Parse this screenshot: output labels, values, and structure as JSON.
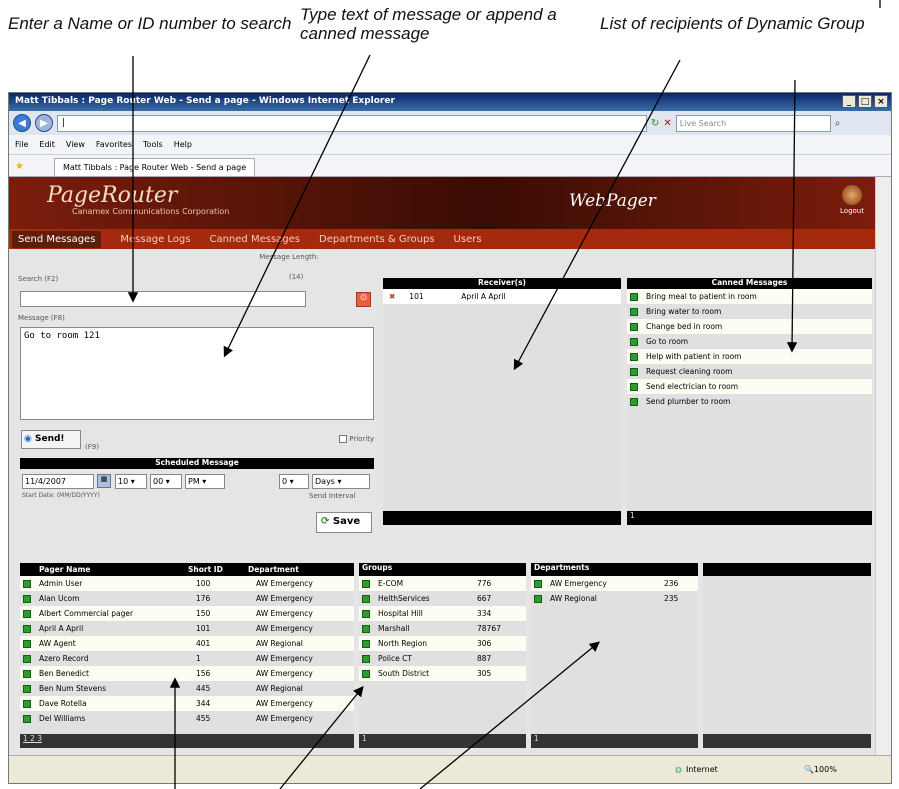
{
  "annotations": {
    "search_hint": "Enter a Name or ID number to search",
    "message_hint": "Type text of message or append a canned message",
    "recipients_hint": "List of recipients of Dynamic Group"
  },
  "browser": {
    "title": "Matt Tibbals : Page Router Web - Send a page - Windows Internet Explorer",
    "address": "|",
    "search_placeholder": "Live Search",
    "menu": [
      "File",
      "Edit",
      "View",
      "Favorites",
      "Tools",
      "Help"
    ],
    "tab_label": "Matt Tibbals : Page Router Web - Send a page",
    "status_zone": "Internet",
    "zoom": "100%"
  },
  "app": {
    "logo_main": "PageRouter",
    "logo_sub": "Canamex Communications Corporation",
    "brand_right": "WebPager",
    "logout_label": "Logout",
    "nav": [
      "Send Messages",
      "Message Logs",
      "Canned Messages",
      "Departments & Groups",
      "Users"
    ],
    "search_label": "Search (F2)",
    "message_length_label": "Message Length:",
    "message_length_value": "(14)",
    "message_label": "Message (F8)",
    "message_value": "Go to room 121",
    "send_label": "Send!",
    "send_shortcut": "(F9)",
    "priority_label": "Priority",
    "scheduled_title": "Scheduled Message",
    "start_date": "11/4/2007",
    "hour": "10",
    "minute": "00",
    "ampm": "PM",
    "interval_value": "0",
    "interval_unit": "Days",
    "start_date_label": "Start Date: (MM/DD/YYYY)",
    "send_interval_label": "Send Interval",
    "save_label": "Save",
    "receivers": {
      "title": "Receiver(s)",
      "rows": [
        {
          "id": "101",
          "name": "April A April"
        }
      ]
    },
    "canned": {
      "title": "Canned Messages",
      "items": [
        "Bring meal to patient in room",
        "Bring water to room",
        "Change bed in room",
        "Go to room",
        "Help with patient in room",
        "Request cleaning room",
        "Send electrician to room",
        "Send plumber to room"
      ],
      "footer": "1"
    },
    "pagers": {
      "headers": [
        "Pager Name",
        "Short ID",
        "Department"
      ],
      "rows": [
        [
          "Admin User",
          "100",
          "AW Emergency"
        ],
        [
          "Alan Ucom",
          "176",
          "AW Emergency"
        ],
        [
          "Albert Commercial pager",
          "150",
          "AW Emergency"
        ],
        [
          "April A April",
          "101",
          "AW Emergency"
        ],
        [
          "AW Agent",
          "401",
          "AW Regional"
        ],
        [
          "Azero Record",
          "1",
          "AW Emergency"
        ],
        [
          "Ben Benedict",
          "156",
          "AW Emergency"
        ],
        [
          "Ben Num Stevens",
          "445",
          "AW Regional"
        ],
        [
          "Dave Rotella",
          "344",
          "AW Emergency"
        ],
        [
          "Del Williams",
          "455",
          "AW Emergency"
        ]
      ],
      "pages": "1 2 3"
    },
    "groups": {
      "title": "Groups",
      "rows": [
        [
          "E-COM",
          "776"
        ],
        [
          "HelthServices",
          "667"
        ],
        [
          "Hospital Hill",
          "334"
        ],
        [
          "Marshall",
          "78767"
        ],
        [
          "North Region",
          "306"
        ],
        [
          "Police CT",
          "887"
        ],
        [
          "South District",
          "305"
        ]
      ],
      "footer": "1"
    },
    "departments": {
      "title": "Departments",
      "rows": [
        [
          "AW Emergency",
          "236"
        ],
        [
          "AW Regional",
          "235"
        ]
      ],
      "footer": "1"
    }
  }
}
